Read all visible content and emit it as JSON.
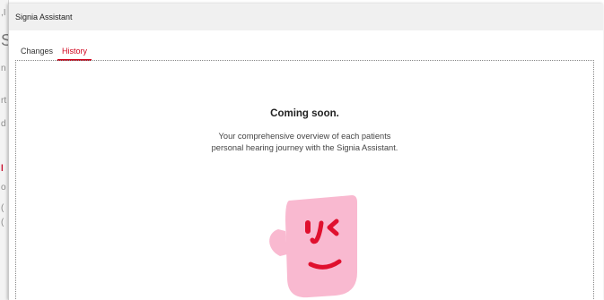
{
  "window": {
    "title": "Signia Assistant"
  },
  "tabs": [
    {
      "label": "Changes",
      "active": false
    },
    {
      "label": "History",
      "active": true
    }
  ],
  "history": {
    "heading": "Coming soon.",
    "description_line1": "Your comprehensive overview of each patients",
    "description_line2": "personal hearing journey with the Signia Assistant."
  },
  "colors": {
    "accent": "#d0021b",
    "mascot_face": "#f9b9d0",
    "mascot_feature": "#e0102e",
    "titlebar_bg": "#f0f0f0"
  },
  "icons": {
    "mascot": "smiling-winking-face"
  }
}
